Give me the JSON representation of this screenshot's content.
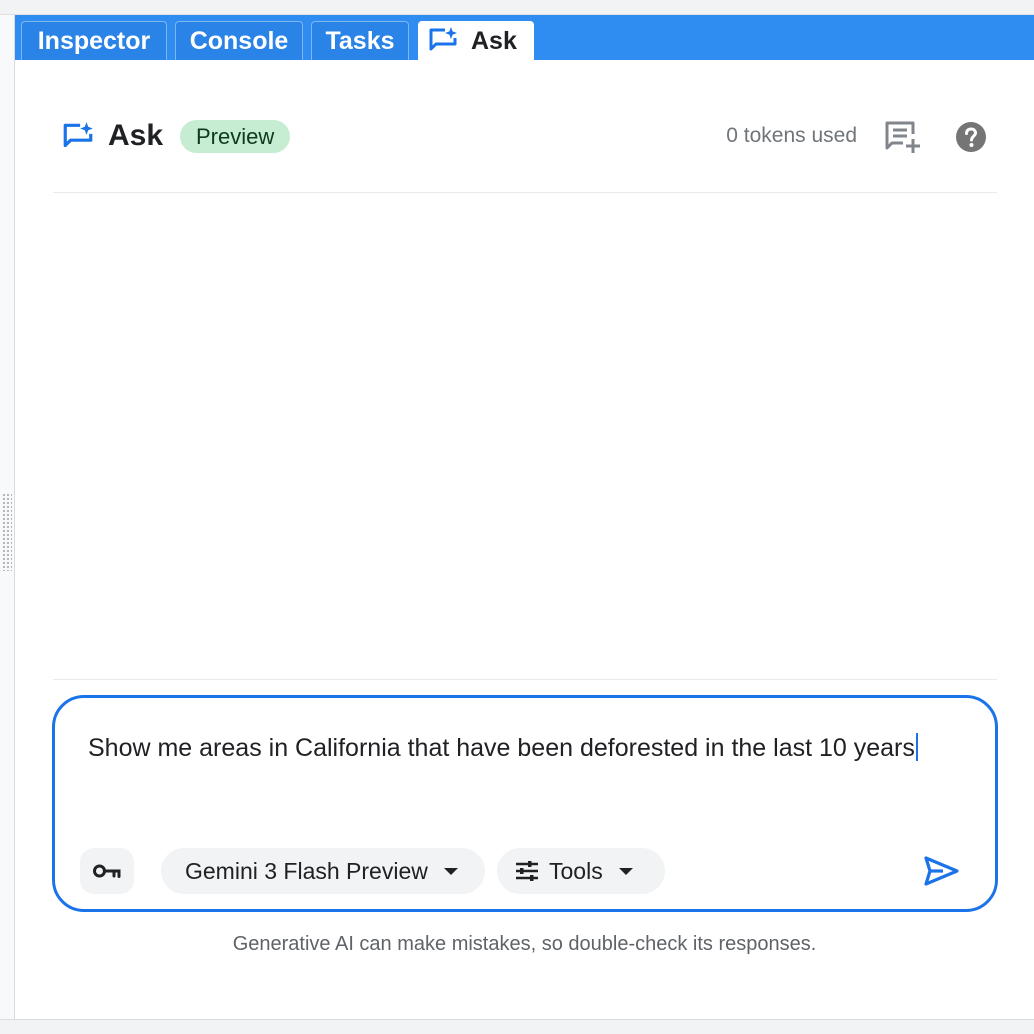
{
  "tabs": [
    {
      "label": "Inspector",
      "active": false
    },
    {
      "label": "Console",
      "active": false
    },
    {
      "label": "Tasks",
      "active": false
    },
    {
      "label": "Ask",
      "active": true,
      "icon": "ask-sparkle-icon"
    }
  ],
  "header": {
    "title": "Ask",
    "badge": "Preview",
    "tokens": "0 tokens used",
    "icons": [
      "ask-sparkle-icon",
      "new-chat-icon",
      "help-icon"
    ]
  },
  "input": {
    "value": "Show me areas in California that have been deforested in the last 10 years",
    "model": "Gemini 3 Flash Preview",
    "tools": "Tools",
    "icons": [
      "key-icon",
      "tune-icon",
      "send-icon"
    ]
  },
  "footer": {
    "disclaimer": "Generative AI can make mistakes, so double-check its responses."
  },
  "colors": {
    "tab_bar": "#2f8cf0",
    "accent": "#1a73e8",
    "badge_bg": "#c6ecd2",
    "chip_bg": "#f1f3f4"
  }
}
